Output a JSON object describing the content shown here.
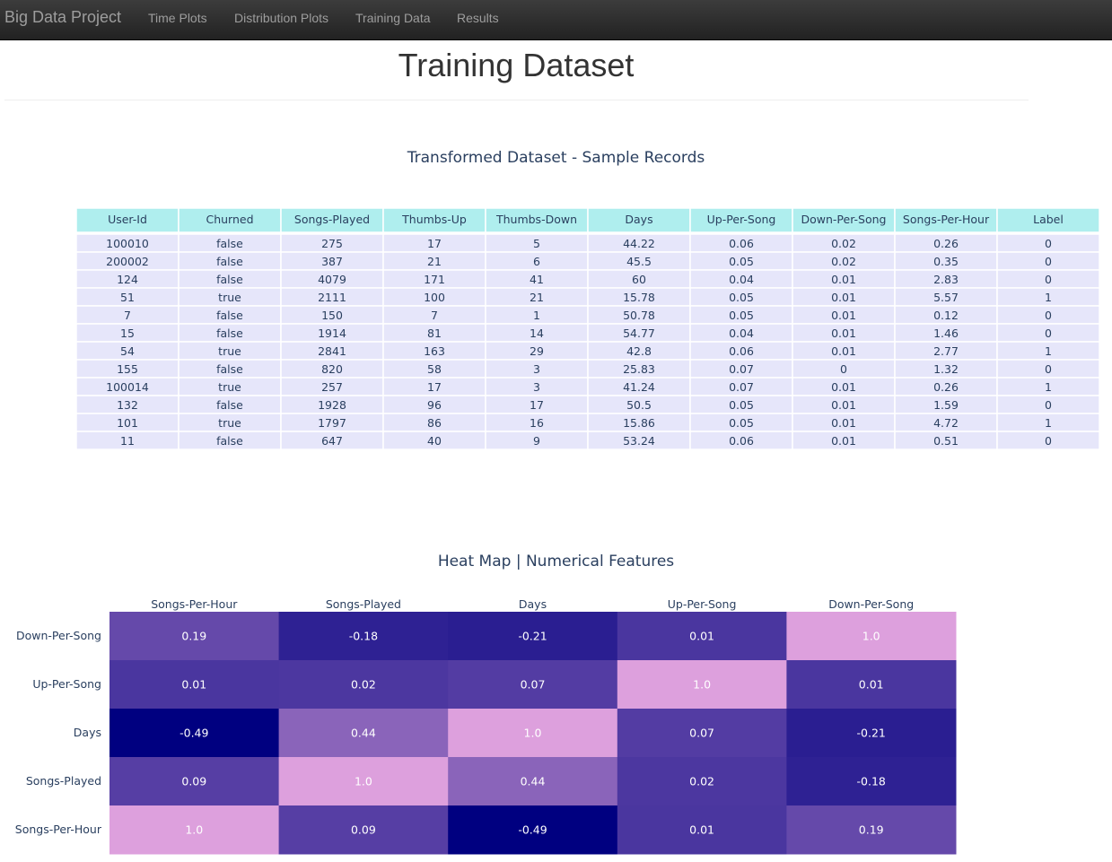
{
  "navbar": {
    "brand": "Big Data Project",
    "links": [
      "Time Plots",
      "Distribution Plots",
      "Training Data",
      "Results"
    ]
  },
  "page": {
    "title": "Training Dataset"
  },
  "table_section": {
    "title": "Transformed Dataset - Sample Records",
    "header_color": "#afeeee",
    "cell_color": "#e6e6fa"
  },
  "heatmap_section": {
    "title": "Heat Map | Numerical Features"
  },
  "chart_data": [
    {
      "type": "table",
      "columns": [
        "User-Id",
        "Churned",
        "Songs-Played",
        "Thumbs-Up",
        "Thumbs-Down",
        "Days",
        "Up-Per-Song",
        "Down-Per-Song",
        "Songs-Per-Hour",
        "Label"
      ],
      "rows": [
        [
          "100010",
          "false",
          "275",
          "17",
          "5",
          "44.22",
          "0.06",
          "0.02",
          "0.26",
          "0"
        ],
        [
          "200002",
          "false",
          "387",
          "21",
          "6",
          "45.5",
          "0.05",
          "0.02",
          "0.35",
          "0"
        ],
        [
          "124",
          "false",
          "4079",
          "171",
          "41",
          "60",
          "0.04",
          "0.01",
          "2.83",
          "0"
        ],
        [
          "51",
          "true",
          "2111",
          "100",
          "21",
          "15.78",
          "0.05",
          "0.01",
          "5.57",
          "1"
        ],
        [
          "7",
          "false",
          "150",
          "7",
          "1",
          "50.78",
          "0.05",
          "0.01",
          "0.12",
          "0"
        ],
        [
          "15",
          "false",
          "1914",
          "81",
          "14",
          "54.77",
          "0.04",
          "0.01",
          "1.46",
          "0"
        ],
        [
          "54",
          "true",
          "2841",
          "163",
          "29",
          "42.8",
          "0.06",
          "0.01",
          "2.77",
          "1"
        ],
        [
          "155",
          "false",
          "820",
          "58",
          "3",
          "25.83",
          "0.07",
          "0",
          "1.32",
          "0"
        ],
        [
          "100014",
          "true",
          "257",
          "17",
          "3",
          "41.24",
          "0.07",
          "0.01",
          "0.26",
          "1"
        ],
        [
          "132",
          "false",
          "1928",
          "96",
          "17",
          "50.5",
          "0.05",
          "0.01",
          "1.59",
          "0"
        ],
        [
          "101",
          "true",
          "1797",
          "86",
          "16",
          "15.86",
          "0.05",
          "0.01",
          "4.72",
          "1"
        ],
        [
          "11",
          "false",
          "647",
          "40",
          "9",
          "53.24",
          "0.06",
          "0.01",
          "0.51",
          "0"
        ]
      ]
    },
    {
      "type": "heatmap",
      "x": [
        "Songs-Per-Hour",
        "Songs-Played",
        "Days",
        "Up-Per-Song",
        "Down-Per-Song"
      ],
      "y": [
        "Down-Per-Song",
        "Up-Per-Song",
        "Days",
        "Songs-Played",
        "Songs-Per-Hour"
      ],
      "z": [
        [
          "0.19",
          "-0.18",
          "-0.21",
          "0.01",
          "1.0"
        ],
        [
          "0.01",
          "0.02",
          "0.07",
          "1.0",
          "0.01"
        ],
        [
          "-0.49",
          "0.44",
          "1.0",
          "0.07",
          "-0.21"
        ],
        [
          "0.09",
          "1.0",
          "0.44",
          "0.02",
          "-0.18"
        ],
        [
          "1.0",
          "0.09",
          "-0.49",
          "0.01",
          "0.19"
        ]
      ],
      "zlim": [
        -0.49,
        1.0
      ],
      "colorscale": [
        "#000080",
        "#dda0dd"
      ]
    }
  ]
}
